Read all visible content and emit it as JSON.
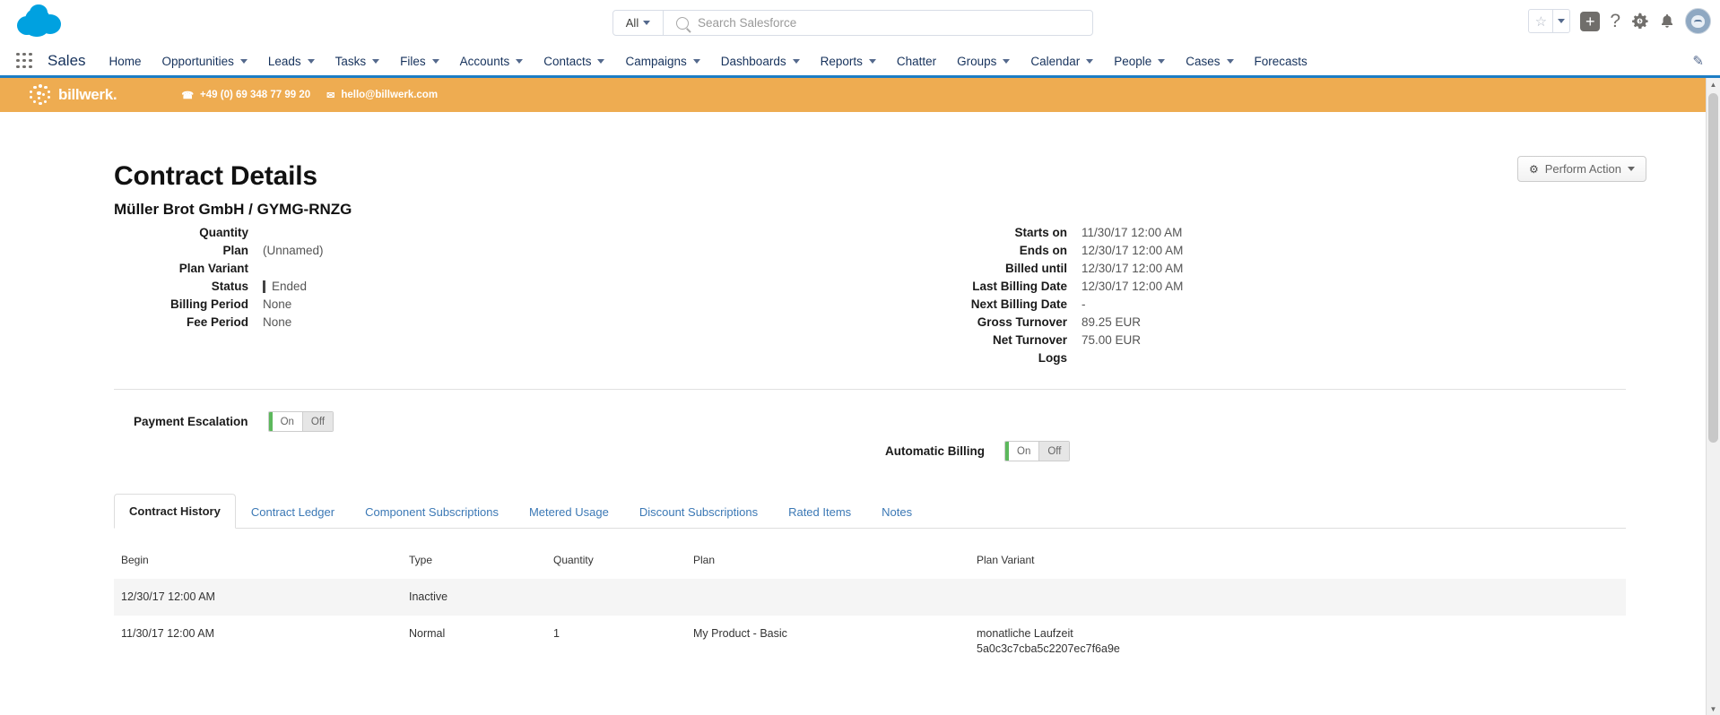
{
  "sf_header": {
    "search": {
      "scope": "All",
      "placeholder": "Search Salesforce",
      "value": ""
    },
    "icons": {
      "favorites": "star-icon",
      "favorites_caret": "chevron-down-icon",
      "add": "plus-icon",
      "help": "question-mark-icon",
      "setup": "gear-icon",
      "notifications": "bell-icon",
      "avatar": "user-avatar"
    }
  },
  "sf_nav": {
    "app_launcher": "app-launcher-icon",
    "app_name": "Sales",
    "edit_icon": "pencil-icon",
    "items": [
      {
        "label": "Home",
        "has_menu": false
      },
      {
        "label": "Opportunities",
        "has_menu": true
      },
      {
        "label": "Leads",
        "has_menu": true
      },
      {
        "label": "Tasks",
        "has_menu": true
      },
      {
        "label": "Files",
        "has_menu": true
      },
      {
        "label": "Accounts",
        "has_menu": true
      },
      {
        "label": "Contacts",
        "has_menu": true
      },
      {
        "label": "Campaigns",
        "has_menu": true
      },
      {
        "label": "Dashboards",
        "has_menu": true
      },
      {
        "label": "Reports",
        "has_menu": true
      },
      {
        "label": "Chatter",
        "has_menu": false
      },
      {
        "label": "Groups",
        "has_menu": true
      },
      {
        "label": "Calendar",
        "has_menu": true
      },
      {
        "label": "People",
        "has_menu": true
      },
      {
        "label": "Cases",
        "has_menu": true
      },
      {
        "label": "Forecasts",
        "has_menu": false
      }
    ]
  },
  "banner": {
    "brand": "billwerk.",
    "phone": "+49 (0) 69 348 77 99 20",
    "email": "hello@billwerk.com",
    "phone_icon": "phone-icon",
    "email_icon": "envelope-icon",
    "background_color": "#eeac51"
  },
  "toolbar": {
    "perform_action_label": "Perform Action",
    "perform_action_icon": "gear-icon",
    "perform_action_caret": "chevron-down-icon"
  },
  "contract": {
    "title": "Contract Details",
    "subtitle": "Müller Brot GmbH / GYMG-RNZG",
    "left_fields": [
      {
        "label": "Quantity",
        "value": ""
      },
      {
        "label": "Plan",
        "value": "(Unnamed)"
      },
      {
        "label": "Plan Variant",
        "value": ""
      },
      {
        "label": "Status",
        "value": "Ended"
      },
      {
        "label": "Billing Period",
        "value": "None"
      },
      {
        "label": "Fee Period",
        "value": "None"
      }
    ],
    "right_fields": [
      {
        "label": "Starts on",
        "value": "11/30/17 12:00 AM"
      },
      {
        "label": "Ends on",
        "value": "12/30/17 12:00 AM"
      },
      {
        "label": "Billed until",
        "value": "12/30/17 12:00 AM"
      },
      {
        "label": "Last Billing Date",
        "value": "12/30/17 12:00 AM"
      },
      {
        "label": "Next Billing Date",
        "value": "-"
      },
      {
        "label": "Gross Turnover",
        "value": "89.25 EUR"
      },
      {
        "label": "Net Turnover",
        "value": "75.00 EUR"
      },
      {
        "label": "Logs",
        "value": ""
      }
    ]
  },
  "toggles": {
    "payment_escalation": {
      "label": "Payment Escalation",
      "on": "On",
      "off": "Off",
      "selected": "On"
    },
    "automatic_billing": {
      "label": "Automatic Billing",
      "on": "On",
      "off": "Off",
      "selected": "On"
    },
    "active_color": "#5cb85c"
  },
  "tabs": [
    {
      "label": "Contract History",
      "active": true
    },
    {
      "label": "Contract Ledger",
      "active": false
    },
    {
      "label": "Component Subscriptions",
      "active": false
    },
    {
      "label": "Metered Usage",
      "active": false
    },
    {
      "label": "Discount Subscriptions",
      "active": false
    },
    {
      "label": "Rated Items",
      "active": false
    },
    {
      "label": "Notes",
      "active": false
    }
  ],
  "history_table": {
    "columns": [
      "Begin",
      "Type",
      "Quantity",
      "Plan",
      "Plan Variant"
    ],
    "rows": [
      {
        "begin": "12/30/17 12:00 AM",
        "type": "Inactive",
        "quantity": "",
        "plan": "",
        "variant": "",
        "variant_id": ""
      },
      {
        "begin": "11/30/17 12:00 AM",
        "type": "Normal",
        "quantity": "1",
        "plan": "My Product - Basic",
        "variant": "monatliche Laufzeit",
        "variant_id": "5a0c3c7cba5c2207ec7f6a9e"
      }
    ]
  }
}
